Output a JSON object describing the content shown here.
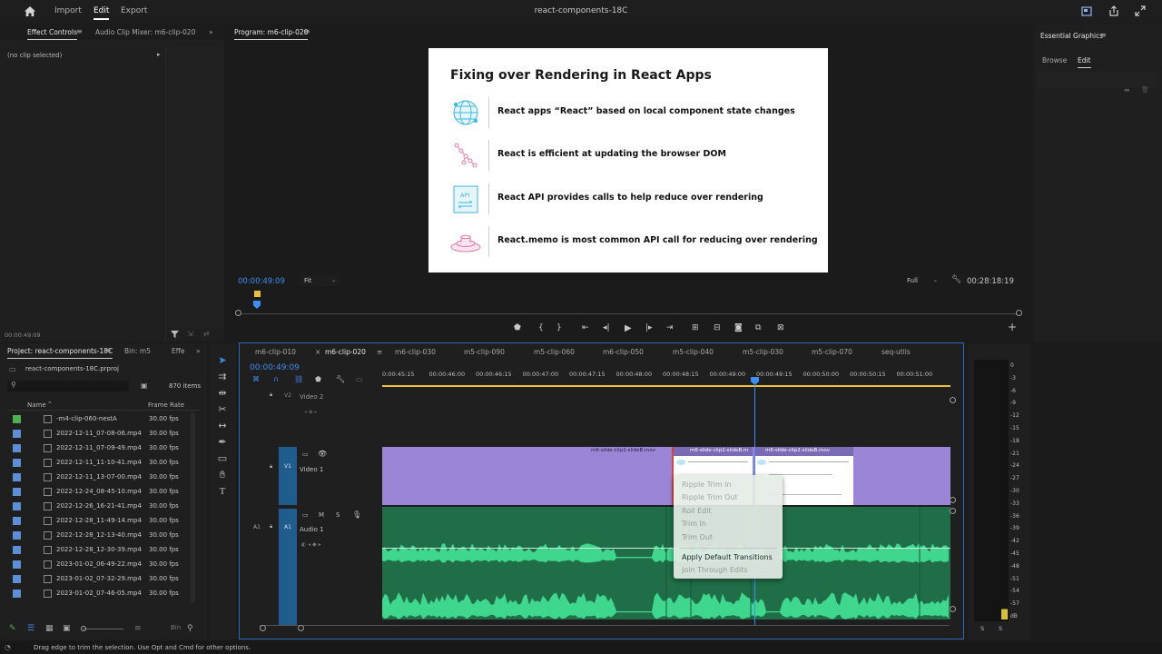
{
  "topbar": {
    "home_icon": "home-icon",
    "nav": [
      "Import",
      "Edit",
      "Export"
    ],
    "active": "Edit",
    "title": "react-components-18C"
  },
  "effect_panel": {
    "tabs": [
      "Effect Controls",
      "Audio Clip Mixer: m6-clip-020"
    ],
    "more": "»",
    "message": "(no clip selected)",
    "timecode": "00:00:49:09"
  },
  "program": {
    "tab": "Program: m6-clip-020",
    "timecode": "00:00:49:09",
    "fit": "Fit",
    "quality": "Full",
    "duration": "00:28:18:19"
  },
  "slide": {
    "title": "Fixing over Rendering in React Apps",
    "items": [
      "React apps “React” based on local component state changes",
      "React is efficient at updating the browser DOM",
      "React API provides calls to help reduce over rendering",
      "React.memo is most common API call for reducing over rendering"
    ],
    "api_label": "API"
  },
  "essential": {
    "title": "Essential Graphics",
    "tabs": [
      "Browse",
      "Edit"
    ]
  },
  "project": {
    "tabs": [
      "Project: react-components-18C",
      "Bin: m5",
      "Effe"
    ],
    "file": "react-components-18C.prproj",
    "count": "870 items",
    "col_name": "Name",
    "col_rate": "Frame Rate",
    "rows": [
      {
        "name": "-m4-clip-060-nestA",
        "rate": "30.00 fps",
        "color": "#4caf50"
      },
      {
        "name": "2022-12-11_07-08-06.mp4",
        "rate": "30.00 fps",
        "color": "#5d8fd6"
      },
      {
        "name": "2022-12-11_07-09-49.mp4",
        "rate": "30.00 fps",
        "color": "#5d8fd6"
      },
      {
        "name": "2022-12-11_11-10-41.mp4",
        "rate": "30.00 fps",
        "color": "#5d8fd6"
      },
      {
        "name": "2022-12-11_13-07-00.mp4",
        "rate": "30.00 fps",
        "color": "#5d8fd6"
      },
      {
        "name": "2022-12-24_08-45-10.mp4",
        "rate": "30.00 fps",
        "color": "#5d8fd6"
      },
      {
        "name": "2022-12-26_16-21-41.mp4",
        "rate": "30.00 fps",
        "color": "#5d8fd6"
      },
      {
        "name": "2022-12-28_11-49-14.mp4",
        "rate": "30.00 fps",
        "color": "#5d8fd6"
      },
      {
        "name": "2022-12-28_12-13-40.mp4",
        "rate": "30.00 fps",
        "color": "#5d8fd6"
      },
      {
        "name": "2022-12-28_12-30-39.mp4",
        "rate": "30.00 fps",
        "color": "#5d8fd6"
      },
      {
        "name": "2023-01-02_06-49-22.mp4",
        "rate": "30.00 fps",
        "color": "#5d8fd6"
      },
      {
        "name": "2023-01-02_07-32-29.mp4",
        "rate": "30.00 fps",
        "color": "#5d8fd6"
      },
      {
        "name": "2023-01-02_07-46-05.mp4",
        "rate": "30.00 fps",
        "color": "#5d8fd6"
      }
    ]
  },
  "timeline": {
    "tabs": [
      "m6-clip-010",
      "m6-clip-020",
      "m6-clip-030",
      "m5-clip-090",
      "m5-clip-060",
      "m6-clip-050",
      "m5-clip-040",
      "m5-clip-030",
      "m5-clip-070",
      "seq-utils"
    ],
    "active_tab": "m6-clip-020",
    "close": "×",
    "timecode": "00:00:49:09",
    "ruler": [
      "0:00:45:15",
      "00:00:46:00",
      "00:00:46:15",
      "00:00:47:00",
      "00:00:47:15",
      "00:00:48:00",
      "00:00:48:15",
      "00:00:49:00",
      "00:00:49:15",
      "00:00:50:00",
      "00:00:50:15",
      "00:00:51:00"
    ],
    "tracks": {
      "v2": {
        "id": "V2",
        "name": "Video 2"
      },
      "v1": {
        "id": "V1",
        "name": "Video 1"
      },
      "a1": {
        "id": "A1",
        "name": "Audio 1"
      }
    },
    "clips": [
      "m6-slide-clip2-slideB.mov",
      "m6-slide-clip2-slideB.m",
      "m6-slide-clip2-slideB.mov"
    ],
    "colors": {
      "video": "#9a85d6",
      "audio": "#1f6e47",
      "wave": "#3fd68e"
    }
  },
  "context_menu": {
    "items": [
      {
        "label": "Ripple Trim In",
        "enabled": false
      },
      {
        "label": "Ripple Trim Out",
        "enabled": false
      },
      {
        "label": "Roll Edit",
        "enabled": false
      },
      {
        "label": "Trim In",
        "enabled": false
      },
      {
        "label": "Trim Out",
        "enabled": false
      },
      {
        "label": "Apply Default Transitions",
        "enabled": true
      },
      {
        "label": "Join Through Edits",
        "enabled": false
      }
    ]
  },
  "meter": {
    "labels": [
      "0",
      "-3",
      "-6",
      "-9",
      "-12",
      "-15",
      "-18",
      "-21",
      "-24",
      "-27",
      "-30",
      "-33",
      "-36",
      "-39",
      "-42",
      "-45",
      "-48",
      "-51",
      "-54",
      "-57",
      "dB"
    ],
    "solo": [
      "S",
      "S"
    ]
  },
  "status": {
    "message": "Drag edge to trim the selection. Use Opt and Cmd for other options."
  }
}
